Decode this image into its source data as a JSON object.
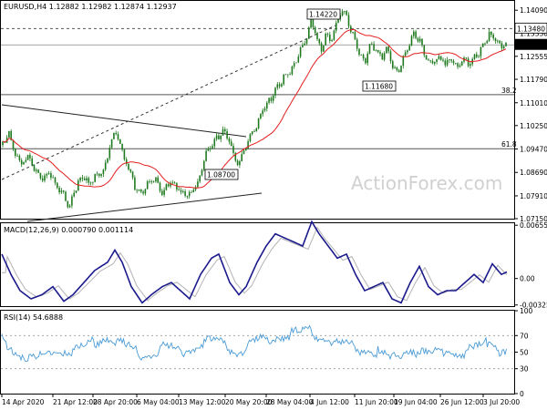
{
  "main_panel": {
    "header": "EURUSD,H4  1.12882 1.12982 1.12874 1.12937",
    "y_ticks": [
      "1.14090",
      "1.13330",
      "1.12555",
      "1.11790",
      "1.11010",
      "1.10250",
      "1.09470",
      "1.08690",
      "1.07910",
      "1.07150"
    ],
    "current_price": "1.12937",
    "resistance_level": "1.13480",
    "fib_382": "38.2",
    "fib_618": "61.8",
    "callouts": {
      "high": "1.14220",
      "low1": "1.11680",
      "low2": "1.08700"
    },
    "watermark": "ActionForex.com"
  },
  "macd_panel": {
    "header": "MACD(12,26,9) 0.000790 0.001114",
    "y_ticks": [
      "0.006554",
      "0.00",
      "-0.003259"
    ]
  },
  "rsi_panel": {
    "header": "RSI(14) 54.6888",
    "y_ticks": [
      "100",
      "70",
      "50",
      "30",
      "0"
    ]
  },
  "x_ticks": [
    "14 Apr 2020",
    "21 Apr 12:00",
    "28 Apr 20:00",
    "6 May 04:00",
    "13 May 12:00",
    "20 May 20:00",
    "28 May 04:00",
    "4 Jun 12:00",
    "11 Jun 20:00",
    "19 Jun 04:00",
    "26 Jun 12:00",
    "3 Jul 20:00"
  ],
  "colors": {
    "candle": "#1f7a1f",
    "ma": "#e51e1e",
    "macd": "#1a1a8c",
    "signal": "#b3b3b3",
    "rsi": "#4a9bd6",
    "guide": "#555555"
  },
  "chart_data": [
    {
      "type": "line",
      "title": "EURUSD,H4",
      "x": [
        "14 Apr 2020",
        "21 Apr 12:00",
        "28 Apr 20:00",
        "6 May 04:00",
        "13 May 12:00",
        "20 May 20:00",
        "28 May 04:00",
        "4 Jun 12:00",
        "11 Jun 20:00",
        "19 Jun 04:00",
        "26 Jun 12:00",
        "3 Jul 20:00"
      ],
      "series": [
        {
          "values": [
            1.095,
            1.086,
            1.084,
            1.08,
            1.079,
            1.092,
            1.11,
            1.138,
            1.13,
            1.123,
            1.124,
            1.1294
          ]
        }
      ],
      "ylim": [
        1.0715,
        1.144
      ],
      "annotations": [
        "1.14220",
        "1.11680",
        "1.08700",
        "1.13480",
        "38.2",
        "61.8"
      ]
    },
    {
      "type": "line",
      "title": "MACD(12,26,9) 0.000790 0.001114",
      "x": [
        "14 Apr 2020",
        "21 Apr 12:00",
        "28 Apr 20:00",
        "6 May 04:00",
        "13 May 12:00",
        "20 May 20:00",
        "28 May 04:00",
        "4 Jun 12:00",
        "11 Jun 20:00",
        "19 Jun 04:00",
        "26 Jun 12:00",
        "3 Jul 20:00"
      ],
      "series": [
        {
          "values": [
            0.002,
            -0.002,
            0.0045,
            -0.0015,
            0.001,
            -0.001,
            0.005,
            0.0065,
            -0.0015,
            -0.003,
            0.0005,
            0.0008
          ]
        }
      ],
      "ylim": [
        -0.003259,
        0.006554
      ]
    },
    {
      "type": "line",
      "title": "RSI(14) 54.6888",
      "x": [
        "14 Apr 2020",
        "21 Apr 12:00",
        "28 Apr 20:00",
        "6 May 04:00",
        "13 May 12:00",
        "20 May 20:00",
        "28 May 04:00",
        "4 Jun 12:00",
        "11 Jun 20:00",
        "19 Jun 04:00",
        "26 Jun 12:00",
        "3 Jul 20:00"
      ],
      "series": [
        {
          "values": [
            60,
            45,
            65,
            45,
            55,
            48,
            70,
            72,
            40,
            38,
            55,
            55
          ]
        }
      ],
      "ylim": [
        0,
        100
      ]
    }
  ]
}
